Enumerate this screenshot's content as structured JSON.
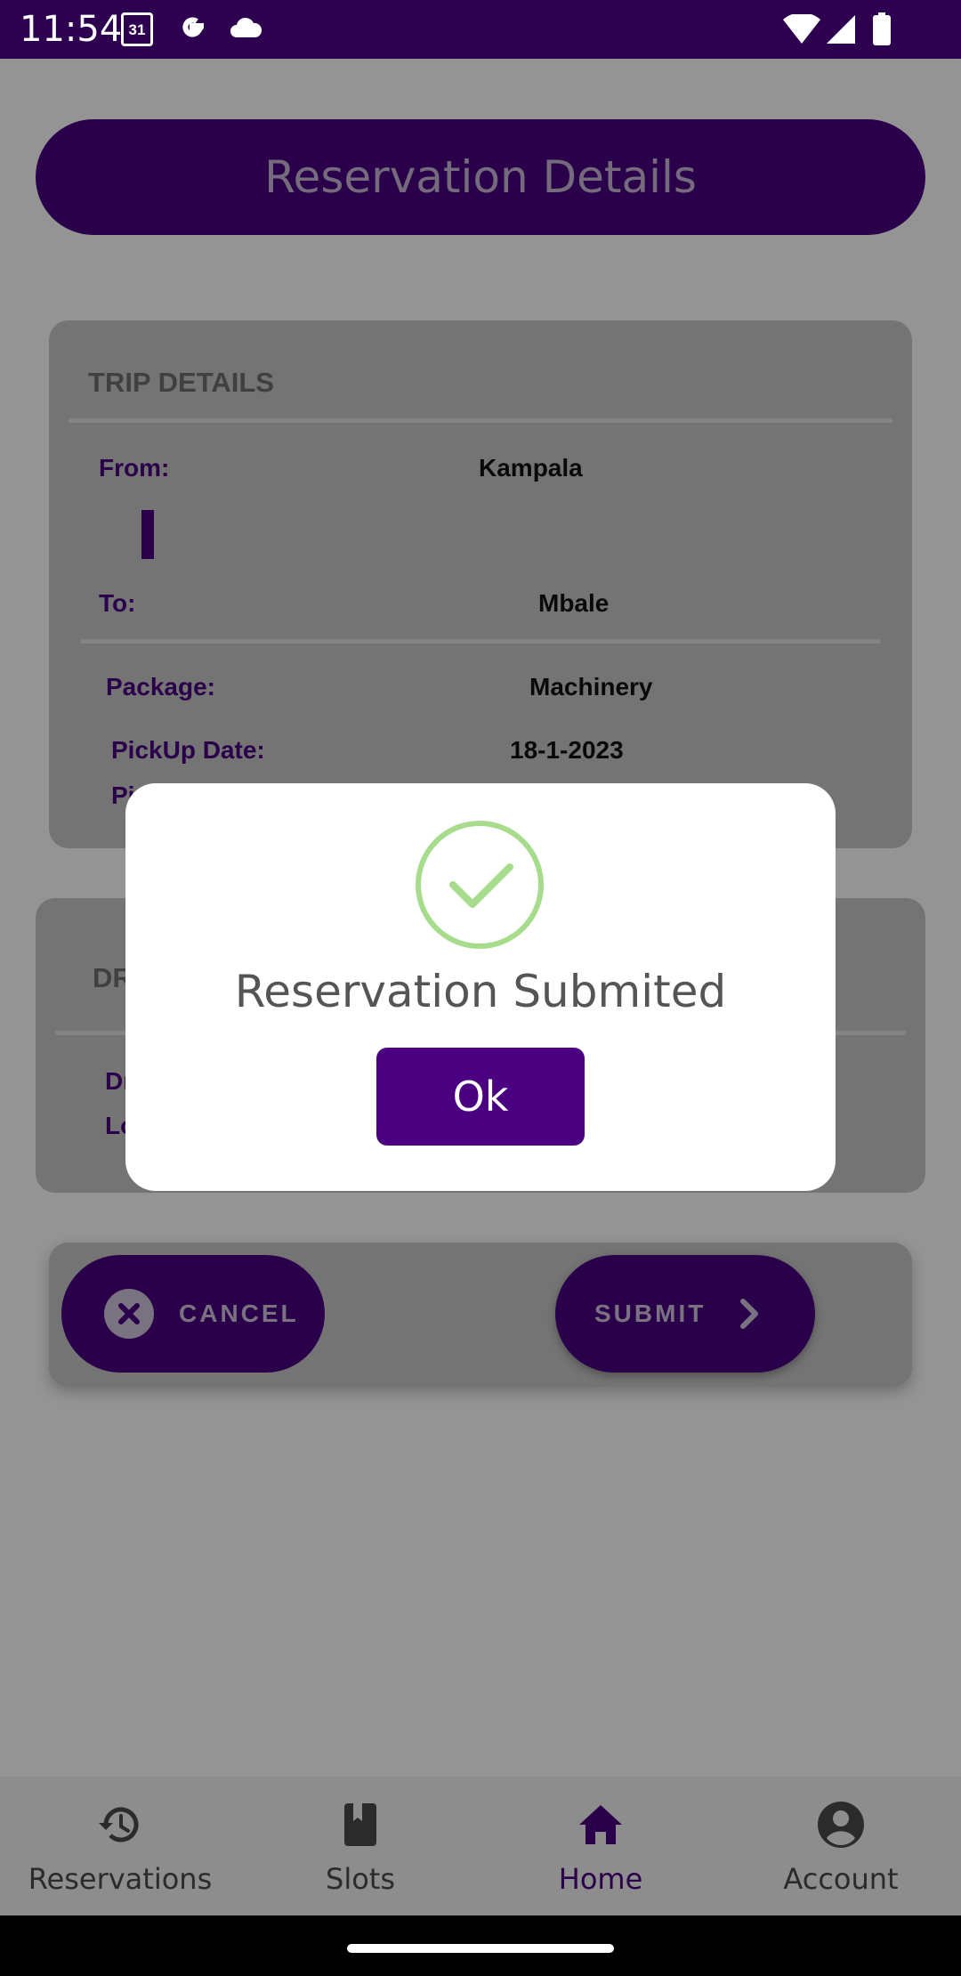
{
  "status_bar": {
    "time": "11:54",
    "calendar_day": "31"
  },
  "header": {
    "title": "Reservation Details"
  },
  "trip_details": {
    "section_title": "TRIP DETAILS",
    "from_label": "From:",
    "from_value": "Kampala",
    "to_label": "To:",
    "to_value": "Mbale",
    "package_label": "Package:",
    "package_value": "Machinery",
    "pickup_date_label": "PickUp Date:",
    "pickup_date_value": "18-1-2023",
    "pickup_time_label_partial": "Pi"
  },
  "driver_details": {
    "section_title_partial": "DR",
    "driver_label_partial": "Dr",
    "location_label_partial": "Lo"
  },
  "actions": {
    "cancel_label": "CANCEL",
    "submit_label": "SUBMIT"
  },
  "bottom_nav": {
    "items": [
      {
        "label": "Reservations",
        "icon": "history-icon"
      },
      {
        "label": "Slots",
        "icon": "book-icon"
      },
      {
        "label": "Home",
        "icon": "home-icon"
      },
      {
        "label": "Account",
        "icon": "account-icon"
      }
    ],
    "active_index": 2
  },
  "dialog": {
    "message": "Reservation Submited",
    "ok_label": "Ok"
  },
  "colors": {
    "primary": "#4b0082",
    "status_bar": "#2e0050",
    "success": "#a6dc8c"
  }
}
